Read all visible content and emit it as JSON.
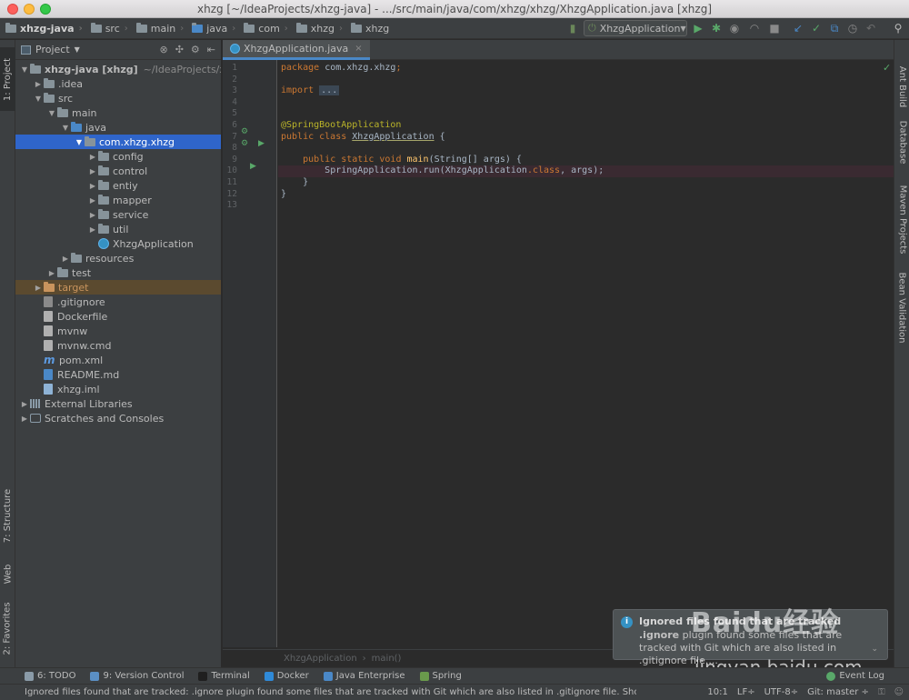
{
  "window": {
    "title": "xhzg [~/IdeaProjects/xhzg-java] - .../src/main/java/com/xhzg/xhzg/XhzgApplication.java [xhzg]"
  },
  "breadcrumbs": [
    "xhzg-java",
    "src",
    "main",
    "java",
    "com",
    "xhzg",
    "xhzg"
  ],
  "run_config": {
    "label": "XhzgApplication"
  },
  "left_stripe": {
    "project": "1: Project",
    "structure": "7: Structure",
    "web": "Web",
    "favorites": "2: Favorites"
  },
  "right_stripe": {
    "ant": "Ant Build",
    "database": "Database",
    "maven": "Maven Projects",
    "bean": "Bean Validation"
  },
  "project_panel": {
    "header": "Project",
    "tree": [
      {
        "label": "xhzg-java [xhzg]",
        "suffix": "~/IdeaProjects/xhzg-java",
        "depth": 0,
        "arrow": "▼",
        "icon": "folder"
      },
      {
        "label": ".idea",
        "depth": 1,
        "arrow": "▶",
        "icon": "folder"
      },
      {
        "label": "src",
        "depth": 1,
        "arrow": "▼",
        "icon": "folder"
      },
      {
        "label": "main",
        "depth": 2,
        "arrow": "▼",
        "icon": "folder"
      },
      {
        "label": "java",
        "depth": 3,
        "arrow": "▼",
        "icon": "folder-blue"
      },
      {
        "label": "com.xhzg.xhzg",
        "depth": 4,
        "arrow": "▼",
        "icon": "package"
      },
      {
        "label": "config",
        "depth": 5,
        "arrow": "▶",
        "icon": "package"
      },
      {
        "label": "control",
        "depth": 5,
        "arrow": "▶",
        "icon": "package"
      },
      {
        "label": "entiy",
        "depth": 5,
        "arrow": "▶",
        "icon": "package"
      },
      {
        "label": "mapper",
        "depth": 5,
        "arrow": "▶",
        "icon": "package"
      },
      {
        "label": "service",
        "depth": 5,
        "arrow": "▶",
        "icon": "package"
      },
      {
        "label": "util",
        "depth": 5,
        "arrow": "▶",
        "icon": "package"
      },
      {
        "label": "XhzgApplication",
        "depth": 5,
        "arrow": "",
        "icon": "class"
      },
      {
        "label": "resources",
        "depth": 3,
        "arrow": "▶",
        "icon": "folder"
      },
      {
        "label": "test",
        "depth": 2,
        "arrow": "▶",
        "icon": "folder"
      },
      {
        "label": "target",
        "depth": 1,
        "arrow": "▶",
        "icon": "folder-orange"
      },
      {
        "label": ".gitignore",
        "depth": 1,
        "arrow": "",
        "icon": "git-file"
      },
      {
        "label": "Dockerfile",
        "depth": 1,
        "arrow": "",
        "icon": "doc-file"
      },
      {
        "label": "mvnw",
        "depth": 1,
        "arrow": "",
        "icon": "doc-file"
      },
      {
        "label": "mvnw.cmd",
        "depth": 1,
        "arrow": "",
        "icon": "doc-file"
      },
      {
        "label": "pom.xml",
        "depth": 1,
        "arrow": "",
        "icon": "maven-file"
      },
      {
        "label": "README.md",
        "depth": 1,
        "arrow": "",
        "icon": "md-file"
      },
      {
        "label": "xhzg.iml",
        "depth": 1,
        "arrow": "",
        "icon": "iml-file"
      },
      {
        "label": "External Libraries",
        "depth": 0,
        "arrow": "▶",
        "icon": "libraries"
      },
      {
        "label": "Scratches and Consoles",
        "depth": 0,
        "arrow": "▶",
        "icon": "scratches"
      }
    ]
  },
  "editor": {
    "tab": "XhzgApplication.java",
    "line_numbers": [
      "1",
      "2",
      "3",
      "4",
      "5",
      "6",
      "7",
      "8",
      "9",
      "10",
      "11",
      "12",
      "13"
    ],
    "lines": {
      "l1_kw": "package",
      "l1_pkg": "com.xhzg.xhzg",
      "l1_end": ";",
      "l3_kw": "import",
      "l3_fold": "...",
      "l6_ann": "@SpringBootApplication",
      "l7_kw": "public class",
      "l7_name": "XhzgApplication",
      "l7_end": " {",
      "l9_kw": "public static void",
      "l9_fn": "main",
      "l9_args": "(String[] args) {",
      "l10_cls": "SpringApplication",
      "l10_call": ".run(",
      "l10_arg": "XhzgApplication",
      "l10_kw": ".class",
      "l10_end": ", args);",
      "l11": "}",
      "l12": "}"
    },
    "footer_crumbs": [
      "XhzgApplication",
      "main()"
    ]
  },
  "notification": {
    "title": "Ignored files found that are tracked",
    "body_bold": ".ignore",
    "body": " plugin found some files that are tracked with Git which are also listed in .gitignore file....",
    "watermark": "Baidu经验",
    "watermark2": "jingyan.baidu.com"
  },
  "tool_windows": [
    {
      "label": "6: TODO",
      "color": "#8a9ba8"
    },
    {
      "label": "9: Version Control",
      "color": "#5b8fc4"
    },
    {
      "label": "Terminal",
      "color": "#1f1f1f"
    },
    {
      "label": "Docker",
      "color": "#2f8ad8"
    },
    {
      "label": "Java Enterprise",
      "color": "#4a88c7"
    },
    {
      "label": "Spring",
      "color": "#6a9a4c"
    }
  ],
  "event_log": "Event Log",
  "status": {
    "message": "Ignored files found that are tracked: .ignore plugin found some files that are tracked with Git which are also listed in .gitignore file. Show details Don't s... (moments ago)",
    "position": "10:1",
    "line_sep": "LF÷",
    "encoding": "UTF-8÷",
    "vcs": "Git: master ÷"
  }
}
